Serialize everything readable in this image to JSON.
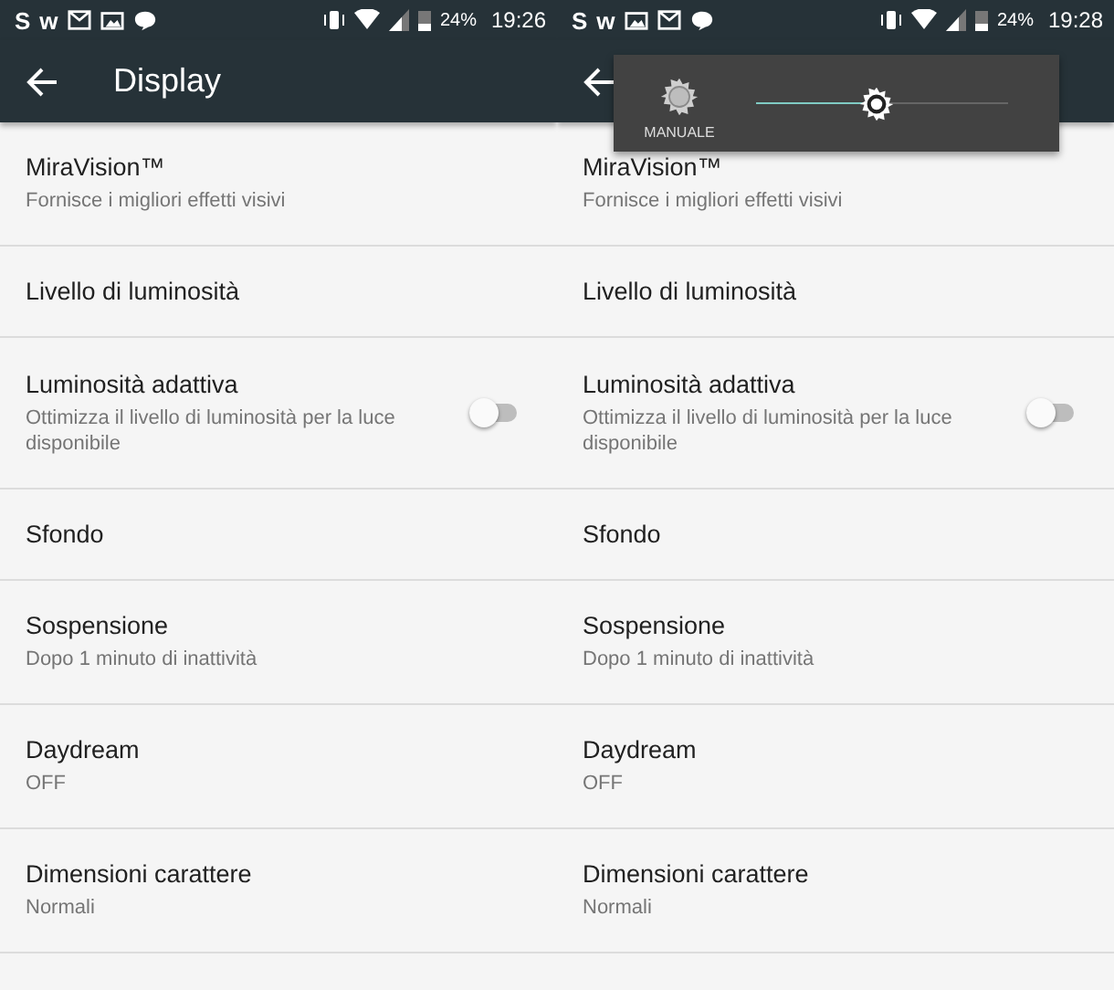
{
  "screens": [
    {
      "status_bar": {
        "apps": [
          "S",
          "w"
        ],
        "icons": [
          {
            "kind": "mail"
          },
          {
            "kind": "image"
          },
          {
            "kind": "chat"
          }
        ],
        "battery": "24%",
        "time": "19:26"
      },
      "title": "Display",
      "settings": [
        {
          "kind": "text",
          "title": "MiraVision™",
          "summary": "Fornisce i migliori effetti visivi"
        },
        {
          "kind": "text",
          "title": "Livello di luminosità"
        },
        {
          "kind": "toggle",
          "title": "Luminosità adattiva",
          "summary": "Ottimizza il livello di luminosità per la luce disponibile",
          "on": false
        },
        {
          "kind": "text",
          "title": "Sfondo"
        },
        {
          "kind": "text",
          "title": "Sospensione",
          "summary": "Dopo 1 minuto di inattività"
        },
        {
          "kind": "text",
          "title": "Daydream",
          "summary": "OFF"
        },
        {
          "kind": "text",
          "title": "Dimensioni carattere",
          "summary": "Normali"
        }
      ]
    },
    {
      "status_bar": {
        "apps": [
          "S",
          "w"
        ],
        "icons": [
          {
            "kind": "image"
          },
          {
            "kind": "mail"
          },
          {
            "kind": "chat"
          }
        ],
        "battery": "24%",
        "time": "19:28"
      },
      "brightness_popup": {
        "mode": "MANUALE",
        "level": 0.48
      },
      "settings": [
        {
          "kind": "text",
          "title": "MiraVision™",
          "summary": "Fornisce i migliori effetti visivi"
        },
        {
          "kind": "text",
          "title": "Livello di luminosità"
        },
        {
          "kind": "toggle",
          "title": "Luminosità adattiva",
          "summary": "Ottimizza il livello di luminosità per la luce disponibile",
          "on": false
        },
        {
          "kind": "text",
          "title": "Sfondo"
        },
        {
          "kind": "text",
          "title": "Sospensione",
          "summary": "Dopo 1 minuto di inattività"
        },
        {
          "kind": "text",
          "title": "Daydream",
          "summary": "OFF"
        },
        {
          "kind": "text",
          "title": "Dimensioni carattere",
          "summary": "Normali"
        }
      ]
    }
  ]
}
